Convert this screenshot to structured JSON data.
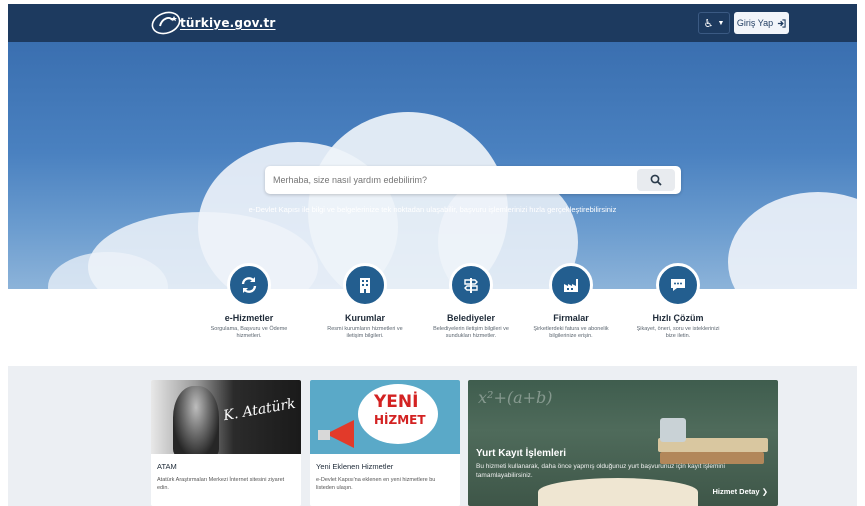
{
  "header": {
    "logo_text": "türkiye.gov.tr",
    "accessibility_label": "♿",
    "login_label": "Giriş Yap"
  },
  "hero": {
    "search_placeholder": "Merhaba, size nasıl yardım edebilirim?",
    "subtitle": "e-Devlet Kapısı ile bilgi ve belgelerinize tek noktadan ulaşabilir, başvuru işlemlerinizi hızla gerçekleştirebilirsiniz"
  },
  "services": [
    {
      "title": "e-Hizmetler",
      "desc": "Sorgulama, Başvuru ve Ödeme hizmetleri.",
      "icon": "refresh-icon"
    },
    {
      "title": "Kurumlar",
      "desc": "Resmi kurumların hizmetleri ve iletişim bilgileri.",
      "icon": "building-icon"
    },
    {
      "title": "Belediyeler",
      "desc": "Belediyelerin iletişim bilgileri ve sundukları hizmetler.",
      "icon": "signpost-icon"
    },
    {
      "title": "Firmalar",
      "desc": "Şirketlerdeki fatura ve abonelik bilgilerinize erişin.",
      "icon": "factory-icon"
    },
    {
      "title": "Hızlı Çözüm",
      "desc": "Şikayet, öneri, soru ve isteklerinizi bize iletin.",
      "icon": "chat-icon"
    }
  ],
  "cards": [
    {
      "title": "ATAM",
      "desc": "Atatürk Araştırmaları Merkezi İnternet sitesini ziyaret edin.",
      "signature": "K. Atatürk"
    },
    {
      "title": "Yeni Eklenen Hizmetler",
      "desc": "e-Devlet Kapısı'na eklenen en yeni hizmetlere bu listeden ulaşın.",
      "banner_line1": "YENİ",
      "banner_line2": "HİZMET"
    }
  ],
  "feature": {
    "title": "Yurt Kayıt İşlemleri",
    "desc": "Bu hizmeti kullanarak, daha önce yapmış olduğunuz yurt başvurunuz için kayıt işlemini tamamlayabilirsiniz.",
    "link": "Hizmet Detay"
  },
  "colors": {
    "header": "#1d3a5f",
    "accent": "#235e8f"
  }
}
